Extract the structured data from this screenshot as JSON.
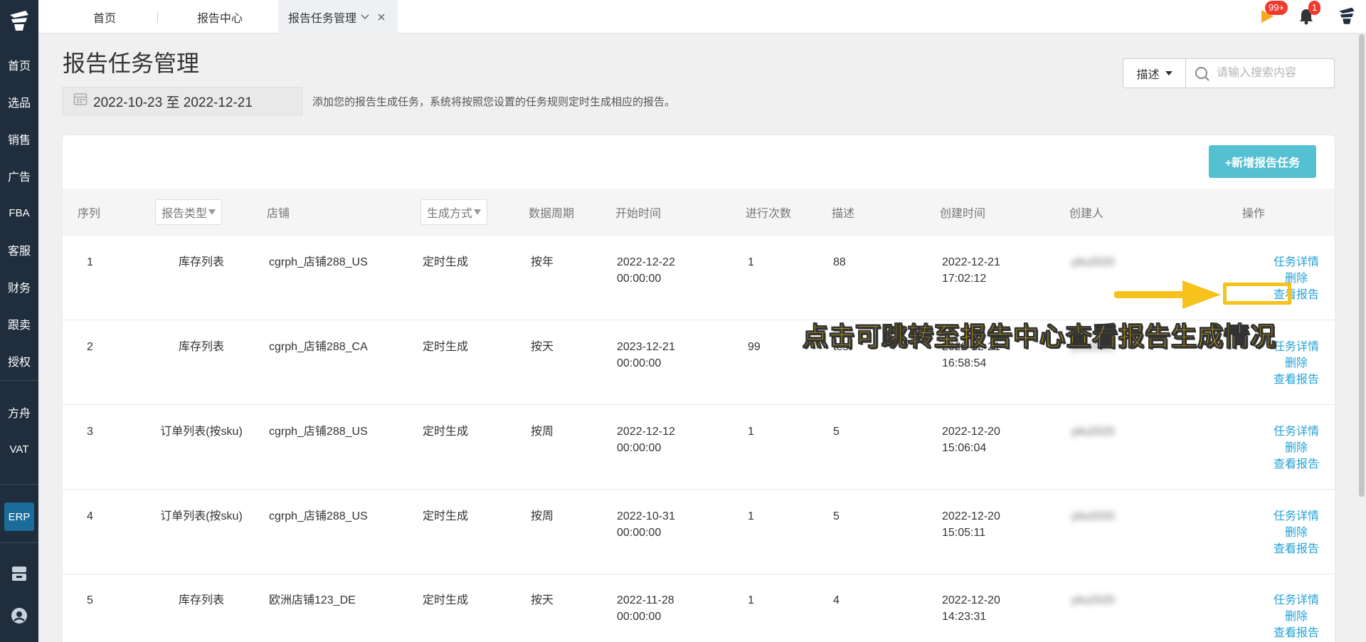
{
  "topbar": {
    "tabs": [
      {
        "label": "首页"
      },
      {
        "label": "报告中心"
      },
      {
        "label": "报告任务管理"
      }
    ],
    "flag_badge": "99+",
    "bell_badge": "1"
  },
  "sidebar": {
    "items": [
      {
        "label": "首页"
      },
      {
        "label": "选品"
      },
      {
        "label": "销售"
      },
      {
        "label": "广告"
      },
      {
        "label": "FBA"
      },
      {
        "label": "客服"
      },
      {
        "label": "财务"
      },
      {
        "label": "跟卖"
      },
      {
        "label": "授权"
      },
      {
        "label": "方舟"
      },
      {
        "label": "VAT"
      }
    ],
    "erp_label": "ERP"
  },
  "page": {
    "title": "报告任务管理",
    "date_range": "2022-10-23 至 2022-12-21",
    "hint": "添加您的报告生成任务，系统将按照您设置的任务规则定时生成相应的报告。",
    "search_select": "描述",
    "search_placeholder": "请输入搜索内容",
    "add_button": "+新增报告任务"
  },
  "table": {
    "headers": {
      "index": "序列",
      "report_type": "报告类型",
      "store": "店铺",
      "gen_mode": "生成方式",
      "period": "数据周期",
      "start_time": "开始时间",
      "run_count": "进行次数",
      "desc": "描述",
      "created_time": "创建时间",
      "creator": "创建人",
      "ops": "操作"
    },
    "op_labels": {
      "detail": "任务详情",
      "delete": "删除",
      "view": "查看报告"
    },
    "rows": [
      {
        "index": "1",
        "report_type": "库存列表",
        "store": "cgrph_店铺288_US",
        "gen_mode": "定时生成",
        "period": "按年",
        "start_date": "2022-12-22",
        "start_clock": "00:00:00",
        "run_count": "1",
        "desc": "88",
        "created_date": "2022-12-21",
        "created_clock": "17:02:12",
        "creator": "yitu2020"
      },
      {
        "index": "2",
        "report_type": "库存列表",
        "store": "cgrph_店铺288_CA",
        "gen_mode": "定时生成",
        "period": "按天",
        "start_date": "2023-12-21",
        "start_clock": "00:00:00",
        "run_count": "99",
        "desc": "test",
        "created_date": "2022-12-21",
        "created_clock": "16:58:54",
        "creator": "yitu2020"
      },
      {
        "index": "3",
        "report_type": "订单列表(按sku)",
        "store": "cgrph_店铺288_US",
        "gen_mode": "定时生成",
        "period": "按周",
        "start_date": "2022-12-12",
        "start_clock": "00:00:00",
        "run_count": "1",
        "desc": "5",
        "created_date": "2022-12-20",
        "created_clock": "15:06:04",
        "creator": "yitu2020"
      },
      {
        "index": "4",
        "report_type": "订单列表(按sku)",
        "store": "cgrph_店铺288_US",
        "gen_mode": "定时生成",
        "period": "按周",
        "start_date": "2022-10-31",
        "start_clock": "00:00:00",
        "run_count": "1",
        "desc": "5",
        "created_date": "2022-12-20",
        "created_clock": "15:05:11",
        "creator": "yitu2020"
      },
      {
        "index": "5",
        "report_type": "库存列表",
        "store": "欧洲店铺123_DE",
        "gen_mode": "定时生成",
        "period": "按天",
        "start_date": "2022-11-28",
        "start_clock": "00:00:00",
        "run_count": "1",
        "desc": "4",
        "created_date": "2022-12-20",
        "created_clock": "14:23:31",
        "creator": "yitu2020"
      }
    ]
  },
  "annotation": {
    "callout": "点击可跳转至报告中心查看报告生成情况",
    "color": "#f7c21b"
  }
}
